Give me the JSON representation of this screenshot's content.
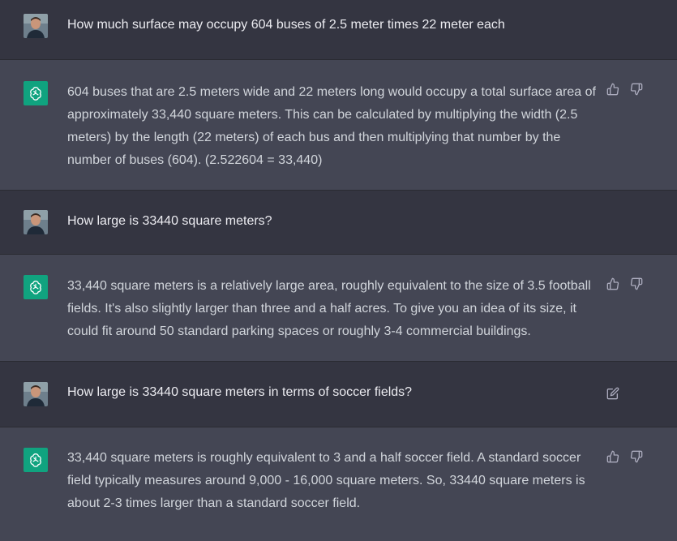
{
  "conversation": {
    "messages": [
      {
        "role": "user",
        "text": "How much surface may occupy 604 buses of 2.5 meter times 22 meter each"
      },
      {
        "role": "assistant",
        "text": "604 buses that are 2.5 meters wide and 22 meters long would occupy a total surface area of approximately 33,440 square meters. This can be calculated by multiplying the width (2.5 meters) by the length (22 meters) of each bus and then multiplying that number by the number of buses (604). (2.522604 = 33,440)"
      },
      {
        "role": "user",
        "text": "How large is 33440 square meters?"
      },
      {
        "role": "assistant",
        "text": "33,440 square meters is a relatively large area, roughly equivalent to the size of 3.5 football fields. It's also slightly larger than three and a half acres. To give you an idea of its size, it could fit around 50 standard parking spaces or roughly 3-4 commercial buildings."
      },
      {
        "role": "user",
        "text": "How large is 33440 square meters in terms of soccer fields?"
      },
      {
        "role": "assistant",
        "text": "33,440 square meters is roughly equivalent to 3 and a half soccer field. A standard soccer field typically measures around 9,000 - 16,000 square meters. So, 33440 square meters is about 2-3 times larger than a standard soccer field."
      }
    ]
  },
  "icons": {
    "user_avatar": "user-avatar-photo",
    "assistant_avatar": "openai-logo-icon",
    "thumbs_up": "thumbs-up-icon",
    "thumbs_down": "thumbs-down-icon",
    "edit": "edit-icon"
  },
  "colors": {
    "background_user": "#343541",
    "background_assistant": "#444654",
    "brand_green": "#10a37f",
    "text": "#ececf1",
    "icon": "#acacbe"
  }
}
